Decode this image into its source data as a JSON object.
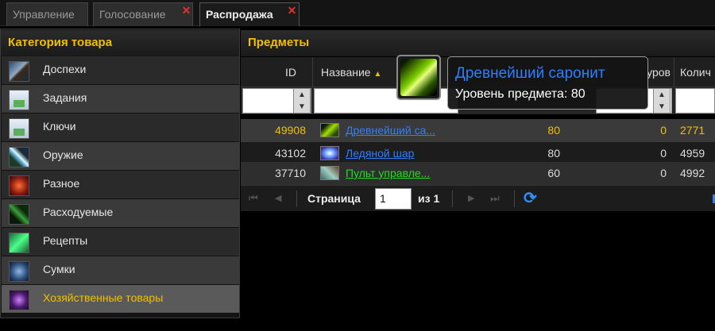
{
  "tabs": [
    {
      "label": "Управление",
      "closable": false,
      "active": false
    },
    {
      "label": "Голосование",
      "closable": true,
      "active": false
    },
    {
      "label": "Распродажа",
      "closable": true,
      "active": true
    }
  ],
  "tab_close_glyph": "✕",
  "category_panel": {
    "title": "Категория товара",
    "items": [
      {
        "label": "Доспехи",
        "icon": "armor-icon",
        "selected": false
      },
      {
        "label": "Задания",
        "icon": "quest-icon",
        "selected": false
      },
      {
        "label": "Ключи",
        "icon": "key-icon",
        "selected": false
      },
      {
        "label": "Оружие",
        "icon": "weapon-icon",
        "selected": false
      },
      {
        "label": "Разное",
        "icon": "misc-icon",
        "selected": false
      },
      {
        "label": "Расходуемые",
        "icon": "consumable-icon",
        "selected": false
      },
      {
        "label": "Рецепты",
        "icon": "recipe-icon",
        "selected": false
      },
      {
        "label": "Сумки",
        "icon": "bag-icon",
        "selected": false
      },
      {
        "label": "Хозяйственные товары",
        "icon": "trade-goods-icon",
        "selected": true
      }
    ]
  },
  "items_panel": {
    "title": "Предметы",
    "columns": {
      "id": "ID",
      "name": "Название",
      "level": "уров",
      "count": "Колич"
    },
    "sort_indicator": "▲",
    "rows": [
      {
        "id": "49908",
        "name": "Древнейший са...",
        "item_level": "80",
        "req_level": "0",
        "count": "2771",
        "name_color": "#2f7fff",
        "highlight": true
      },
      {
        "id": "43102",
        "name": "Ледяной шар",
        "item_level": "80",
        "req_level": "0",
        "count": "4959",
        "name_color": "#2f7fff",
        "highlight": false
      },
      {
        "id": "37710",
        "name": "Пульт управле...",
        "item_level": "60",
        "req_level": "0",
        "count": "4992",
        "name_color": "#22dd22",
        "highlight": false
      }
    ]
  },
  "pager": {
    "page_label": "Страница",
    "page_value": "1",
    "of_label": "из 1",
    "first": "⏮",
    "prev": "◀",
    "next": "▶",
    "last": "⏭",
    "refresh": "⟳"
  },
  "tooltip": {
    "name": "Древнейший саронит",
    "item_level_text": "Уровень предмета: 80",
    "name_color": "#2f7fff"
  },
  "colors": {
    "accent": "#f0c000",
    "rare": "#2f7fff",
    "uncommon": "#22dd22",
    "close": "#e03030"
  }
}
